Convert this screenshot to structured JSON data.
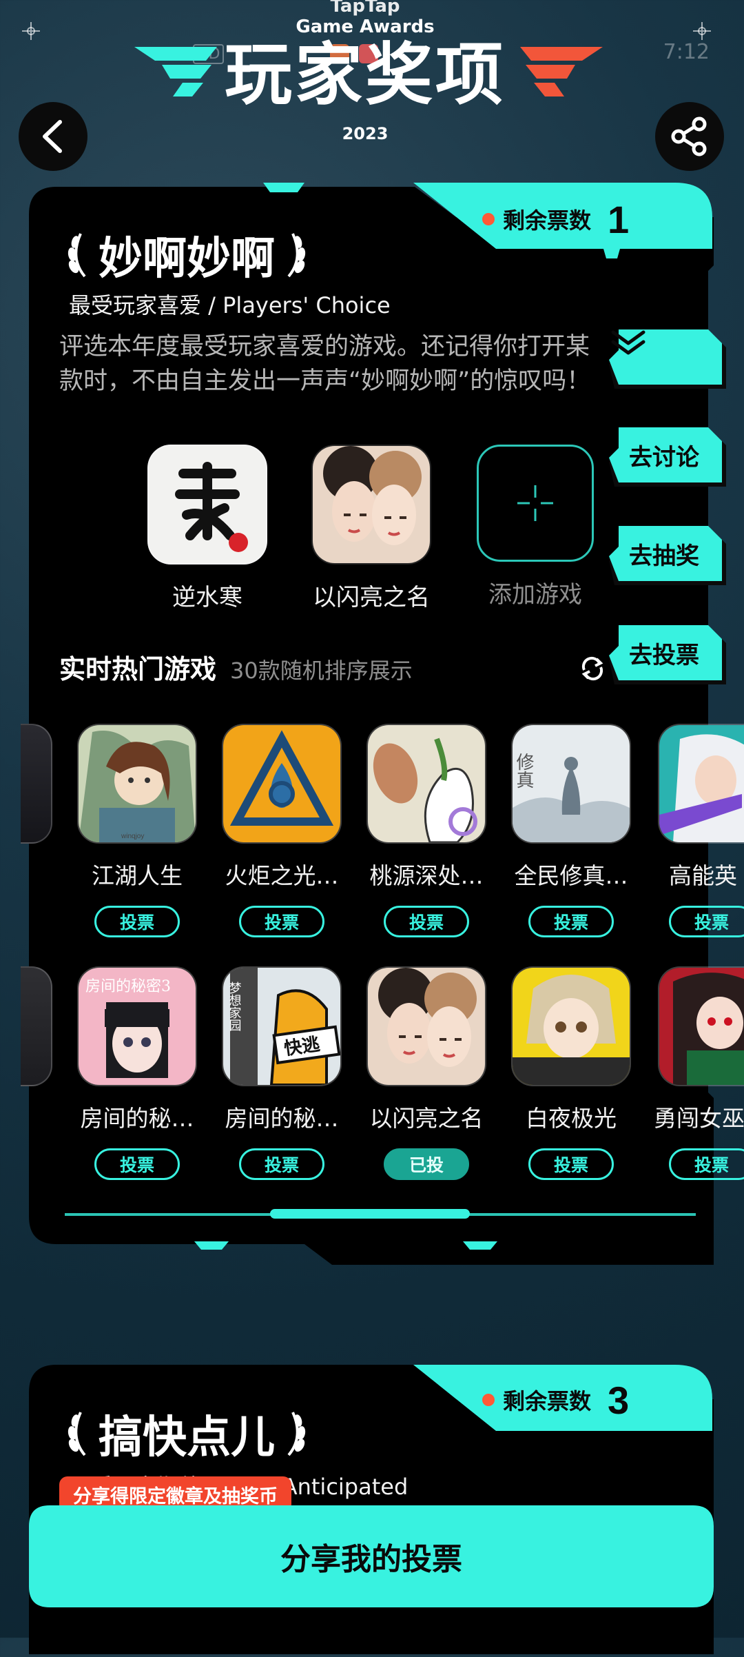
{
  "status_bar": {
    "time": "7:12",
    "hd_label": "HD"
  },
  "header": {
    "taptap": "TapTap",
    "awards_en": "Game Awards",
    "title": "玩家奖项",
    "year": "2023",
    "back_icon": "chevron-left-icon",
    "share_icon": "share-icon"
  },
  "award1": {
    "remaining_label": "剩余票数",
    "remaining_count": "1",
    "name": "妙啊妙啊",
    "subtitle": "最受玩家喜爱 / Players' Choice",
    "description": "评选本年度最受玩家喜爱的游戏。还记得你打开某款时，不由自主发出一声声“妙啊妙啊”的惊叹吗！",
    "selected": [
      {
        "name": "逆水寒"
      },
      {
        "name": "以闪亮之名"
      }
    ],
    "add_label": "添加游戏"
  },
  "side_buttons": {
    "collapse_icon": "double-chevron-down-icon",
    "discuss": "去讨论",
    "lottery": "去抽奖",
    "vote": "去投票"
  },
  "hot": {
    "title": "实时热门游戏",
    "subtitle": "30款随机排序展示",
    "row1": [
      {
        "name": "江湖人生",
        "btn": "投票"
      },
      {
        "name": "火炬之光…",
        "btn": "投票"
      },
      {
        "name": "桃源深处…",
        "btn": "投票"
      },
      {
        "name": "全民修真…",
        "btn": "投票"
      },
      {
        "name": "高能英",
        "btn": "投票"
      }
    ],
    "row2": [
      {
        "name": "房间的秘…",
        "btn": "投票"
      },
      {
        "name": "房间的秘…",
        "btn": "投票"
      },
      {
        "name": "以闪亮之名",
        "btn": "已投"
      },
      {
        "name": "白夜极光",
        "btn": "投票"
      },
      {
        "name": "勇闯女巫",
        "btn": "投票"
      }
    ],
    "thumb_text_1": "房间的秘密3",
    "thumb_text_2": "梦想家园",
    "thumb_text_3": "快逃",
    "thumb_text_4": "winqjoy",
    "thumb_text_5": "修真"
  },
  "award2": {
    "remaining_label": "剩余票数",
    "remaining_count": "3",
    "name": "搞快点儿",
    "subtitle_visible": "最受玩家期待 / Most Anticipated",
    "promo": "分享得限定徽章及抽奖币",
    "share_button": "分享我的投票"
  },
  "colors": {
    "accent": "#38f2e0",
    "orange": "#ff5a36",
    "red_tag": "#f2452c",
    "card": "#000000"
  }
}
